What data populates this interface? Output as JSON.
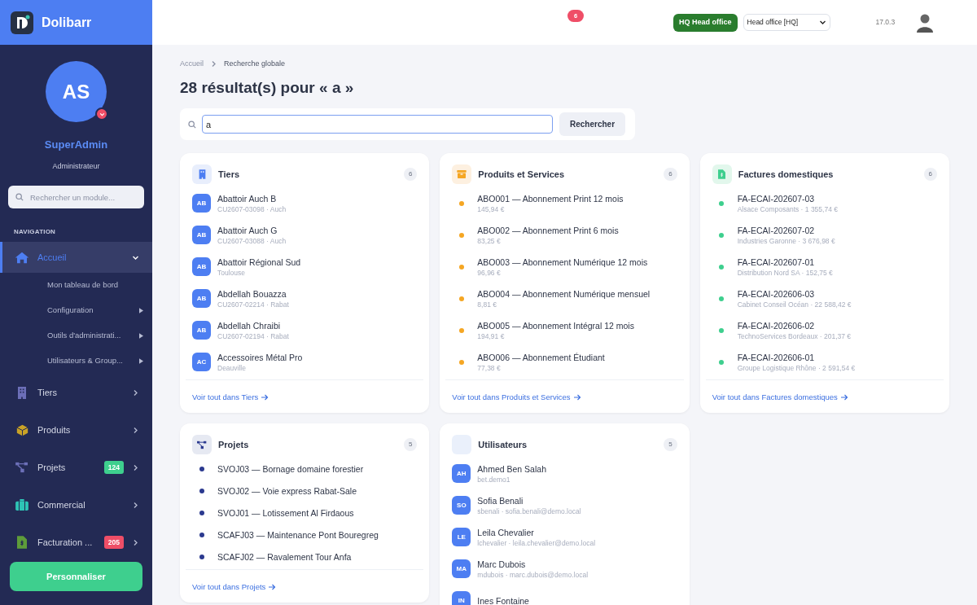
{
  "brand": {
    "name": "Dolibarr"
  },
  "user": {
    "initials": "AS",
    "name": "SuperAdmin",
    "role": "Administrateur"
  },
  "sidebar_search": {
    "placeholder": "Rechercher un module..."
  },
  "nav_heading": "NAVIGATION",
  "nav": [
    {
      "kind": "home",
      "label": "Accueil",
      "selected": true,
      "expanded": true,
      "children": [
        {
          "label": "Mon tableau de bord",
          "has_submenu": false
        },
        {
          "label": "Configuration",
          "has_submenu": true
        },
        {
          "label": "Outils d'administrati...",
          "has_submenu": true
        },
        {
          "label": "Utilisateurs & Group...",
          "has_submenu": true
        }
      ]
    },
    {
      "kind": "building",
      "label": "Tiers",
      "selected": false,
      "expanded": false
    },
    {
      "kind": "box",
      "label": "Produits",
      "selected": false,
      "expanded": false
    },
    {
      "kind": "tree",
      "label": "Projets",
      "selected": false,
      "expanded": false,
      "badge": {
        "text": "124",
        "color": "#3ecf8e"
      }
    },
    {
      "kind": "case",
      "label": "Commercial",
      "selected": false,
      "expanded": false
    },
    {
      "kind": "invoice",
      "label": "Facturation ...",
      "selected": false,
      "expanded": false,
      "badge": {
        "text": "205",
        "color": "#ef4e67"
      }
    }
  ],
  "customize_button": "Personnaliser",
  "topbar": {
    "notification_count": "6",
    "entity_button": "HQ Head office",
    "entity_select": "Head office [HQ]",
    "version": "17.0.3"
  },
  "breadcrumb": [
    "Accueil",
    "Recherche globale"
  ],
  "title": "28 résultat(s) pour « a »",
  "search": {
    "value": "a",
    "button": "Rechercher"
  },
  "cards": [
    {
      "kind": "building",
      "title": "Tiers",
      "count": "6",
      "link": "Voir tout dans Tiers",
      "items": [
        {
          "kind": "avatar",
          "initials": "AB",
          "title": "Abattoir Auch B",
          "subtitle": "CU2607-03098 · Auch"
        },
        {
          "kind": "avatar",
          "initials": "AB",
          "title": "Abattoir Auch G",
          "subtitle": "CU2607-03088 · Auch"
        },
        {
          "kind": "avatar",
          "initials": "AB",
          "title": "Abattoir Régional Sud",
          "subtitle": "Toulouse"
        },
        {
          "kind": "avatar",
          "initials": "AB",
          "title": "Abdellah Bouazza",
          "subtitle": "CU2607-02214 · Rabat"
        },
        {
          "kind": "avatar",
          "initials": "AB",
          "title": "Abdellah Chraibi",
          "subtitle": "CU2607-02194 · Rabat"
        },
        {
          "kind": "avatar",
          "initials": "AC",
          "title": "Accessoires Métal Pro",
          "subtitle": "Deauville"
        }
      ]
    },
    {
      "kind": "box",
      "title": "Produits et Services",
      "count": "6",
      "link": "Voir tout dans Produits et Services",
      "items": [
        {
          "kind": "dot",
          "color": "#f5a623",
          "title": "ABO001 — Abonnement Print 12 mois",
          "subtitle": "145,94 €"
        },
        {
          "kind": "dot",
          "color": "#f5a623",
          "title": "ABO002 — Abonnement Print 6 mois",
          "subtitle": "83,25 €"
        },
        {
          "kind": "dot",
          "color": "#f5a623",
          "title": "ABO003 — Abonnement Numérique 12 mois",
          "subtitle": "96,96 €"
        },
        {
          "kind": "dot",
          "color": "#f5a623",
          "title": "ABO004 — Abonnement Numérique mensuel",
          "subtitle": "8,81 €"
        },
        {
          "kind": "dot",
          "color": "#f5a623",
          "title": "ABO005 — Abonnement Intégral 12 mois",
          "subtitle": "194,91 €"
        },
        {
          "kind": "dot",
          "color": "#f5a623",
          "title": "ABO006 — Abonnement Étudiant",
          "subtitle": "77,38 €"
        }
      ]
    },
    {
      "kind": "invoice",
      "title": "Factures domestiques",
      "count": "6",
      "link": "Voir tout dans Factures domestiques",
      "items": [
        {
          "kind": "dot",
          "color": "#3ecf8e",
          "title": "FA-ECAI-202607-03",
          "subtitle": "Alsace Composants · 1 355,74 €"
        },
        {
          "kind": "dot",
          "color": "#3ecf8e",
          "title": "FA-ECAI-202607-02",
          "subtitle": "Industries Garonne · 3 676,98 €"
        },
        {
          "kind": "dot",
          "color": "#3ecf8e",
          "title": "FA-ECAI-202607-01",
          "subtitle": "Distribution Nord SA · 152,75 €"
        },
        {
          "kind": "dot",
          "color": "#3ecf8e",
          "title": "FA-ECAI-202606-03",
          "subtitle": "Cabinet Conseil Océan · 22 588,42 €"
        },
        {
          "kind": "dot",
          "color": "#3ecf8e",
          "title": "FA-ECAI-202606-02",
          "subtitle": "TechnoServices Bordeaux · 201,37 €"
        },
        {
          "kind": "dot",
          "color": "#3ecf8e",
          "title": "FA-ECAI-202606-01",
          "subtitle": "Groupe Logistique Rhône · 2 591,54 €"
        }
      ]
    },
    {
      "kind": "tree",
      "title": "Projets",
      "count": "5",
      "link": "Voir tout dans Projets",
      "items": [
        {
          "kind": "dot",
          "color": "#2b3a8f",
          "title": "SVOJ03 — Bornage domaine forestier"
        },
        {
          "kind": "dot",
          "color": "#2b3a8f",
          "title": "SVOJ02 — Voie express Rabat-Sale"
        },
        {
          "kind": "dot",
          "color": "#2b3a8f",
          "title": "SVOJ01 — Lotissement Al Firdaous"
        },
        {
          "kind": "dot",
          "color": "#2b3a8f",
          "title": "SCAFJ03 — Maintenance Pont Bouregreg"
        },
        {
          "kind": "dot",
          "color": "#2b3a8f",
          "title": "SCAFJ02 — Ravalement Tour Anfa"
        }
      ]
    },
    {
      "kind": "blank",
      "title": "Utilisateurs",
      "count": "5",
      "items": [
        {
          "kind": "avatar",
          "initials": "AH",
          "title": "Ahmed Ben Salah",
          "subtitle": "bet.demo1"
        },
        {
          "kind": "avatar",
          "initials": "SO",
          "title": "Sofia Benali",
          "subtitle": "sbenali · sofia.benali@demo.local"
        },
        {
          "kind": "avatar",
          "initials": "LE",
          "title": "Leila Chevalier",
          "subtitle": "lchevalier · leila.chevalier@demo.local"
        },
        {
          "kind": "avatar",
          "initials": "MA",
          "title": "Marc Dubois",
          "subtitle": "mdubois · marc.dubois@demo.local"
        },
        {
          "kind": "avatar",
          "initials": "IN",
          "title": "Ines Fontaine"
        }
      ]
    }
  ]
}
